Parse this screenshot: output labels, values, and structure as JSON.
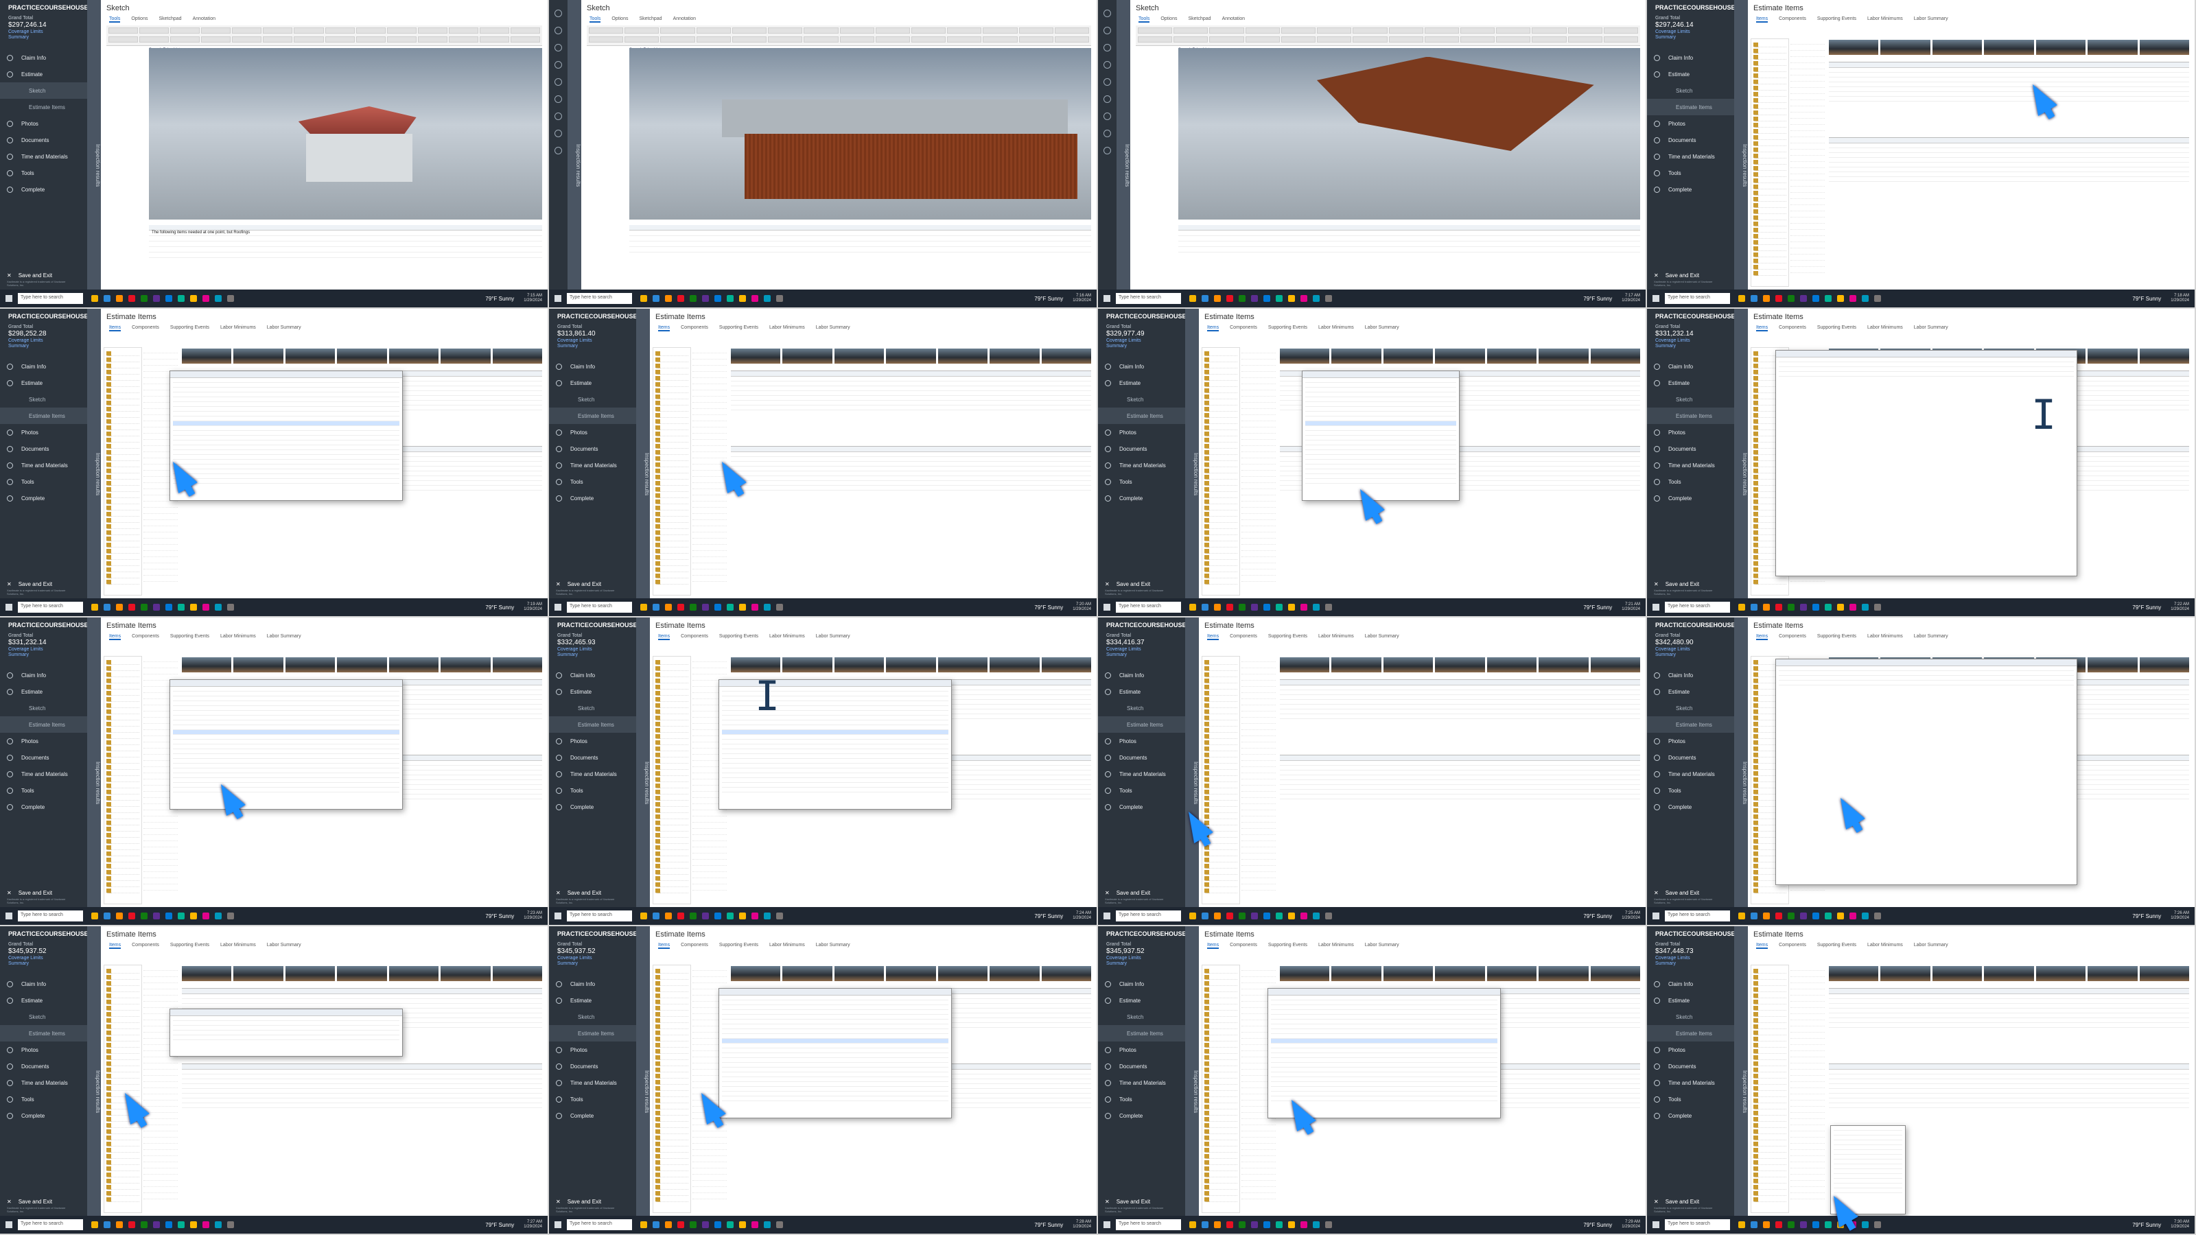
{
  "app": {
    "brand": "PRACTICECOURSEHOUSE",
    "grand_total_label": "Grand Total",
    "coverage_limits": "Coverage Limits",
    "summary": "Summary",
    "nav": [
      "Claim Info",
      "Estimate",
      "Sketch",
      "Estimate Items",
      "Photos",
      "Documents",
      "Time and Materials",
      "Tools",
      "Complete"
    ],
    "save_exit": "Save and Exit",
    "legal": "Xactimate is a registered trademark of Xactware Solutions, Inc.",
    "inspection_results": "Inspection results",
    "tabs": [
      "Items",
      "Components",
      "Supporting Events",
      "Labor Minimums",
      "Labor Summary"
    ],
    "sketch_tabs": [
      "Tools",
      "Options",
      "Sketchpad",
      "Annotation"
    ],
    "sketch_search": "Search Price List - RHCUSN",
    "estimate_items_title": "Estimate Items",
    "sketch_title": "Sketch",
    "taskbar_search": "Type here to search",
    "weather": "79°F Sunny",
    "sketch_note": "The following items needed at one point, but Roofings"
  },
  "panels": [
    {
      "view": "sketch",
      "variant": "roof",
      "total": "$297,246.14",
      "clock": "7:15 AM\n1/29/2024"
    },
    {
      "view": "sketch",
      "variant": "siding",
      "total": "",
      "clock": "7:16 AM\n1/29/2024"
    },
    {
      "view": "sketch",
      "variant": "roof-under",
      "total": "",
      "clock": "7:17 AM\n1/29/2024"
    },
    {
      "view": "estimate",
      "variant": "form",
      "total": "$297,246.14",
      "clock": "7:18 AM\n1/29/2024"
    },
    {
      "view": "estimate",
      "variant": "dialog",
      "total": "$298,252.28",
      "clock": "7:19 AM\n1/29/2024"
    },
    {
      "view": "estimate",
      "variant": "table",
      "total": "$313,861.40",
      "clock": "7:20 AM\n1/29/2024"
    },
    {
      "view": "estimate",
      "variant": "calc",
      "total": "$329,977.49",
      "clock": "7:21 AM\n1/29/2024"
    },
    {
      "view": "estimate",
      "variant": "notes",
      "total": "$331,232.14",
      "clock": "7:22 AM\n1/29/2024"
    },
    {
      "view": "estimate",
      "variant": "dialog",
      "total": "$331,232.14",
      "clock": "7:23 AM\n1/29/2024"
    },
    {
      "view": "estimate",
      "variant": "dialog",
      "total": "$332,465.93",
      "clock": "7:24 AM\n1/29/2024"
    },
    {
      "view": "estimate",
      "variant": "form-wood",
      "total": "$334,416.37",
      "clock": "7:25 AM\n1/29/2024"
    },
    {
      "view": "estimate",
      "variant": "notes",
      "total": "$342,480.90",
      "clock": "7:26 AM\n1/29/2024"
    },
    {
      "view": "estimate",
      "variant": "group",
      "total": "$345,937.52",
      "clock": "7:27 AM\n1/29/2024"
    },
    {
      "view": "estimate",
      "variant": "dialog",
      "total": "$345,937.52",
      "clock": "7:28 AM\n1/29/2024"
    },
    {
      "view": "estimate",
      "variant": "dialog",
      "total": "$345,937.52",
      "clock": "7:29 AM\n1/29/2024"
    },
    {
      "view": "estimate",
      "variant": "menu",
      "total": "$347,448.73",
      "clock": "7:30 AM\n1/29/2024"
    }
  ]
}
